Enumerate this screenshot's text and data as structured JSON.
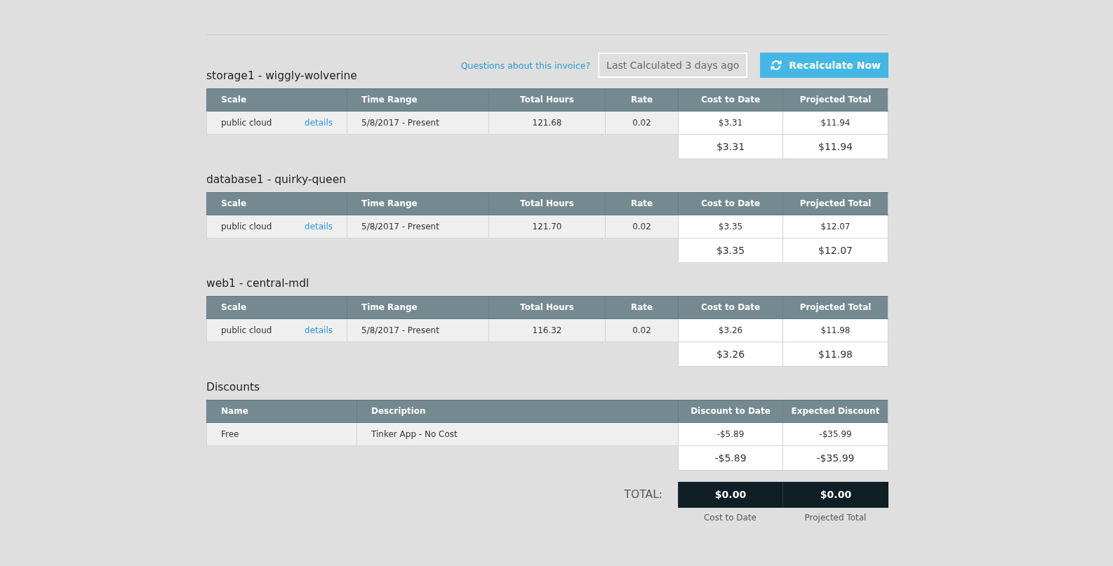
{
  "header": {
    "help_link": "Questions about this invoice?",
    "last_calculated": "Last Calculated 3 days ago",
    "recalculate_button": "Recalculate Now"
  },
  "sections": [
    {
      "title": "storage1 - wiggly-wolverine",
      "columns": [
        "Scale",
        "Time Range",
        "Total Hours",
        "Rate",
        "Cost to Date",
        "Projected Total"
      ],
      "rows": [
        {
          "cells": [
            "public cloud",
            "5/8/2017 - Present",
            "121.68",
            "0.02",
            "$3.31",
            "$11.94"
          ],
          "link": "details"
        }
      ],
      "subtotal": [
        "$3.31",
        "$11.94"
      ]
    },
    {
      "title": "database1 - quirky-queen",
      "columns": [
        "Scale",
        "Time Range",
        "Total Hours",
        "Rate",
        "Cost to Date",
        "Projected Total"
      ],
      "rows": [
        {
          "cells": [
            "public cloud",
            "5/8/2017 - Present",
            "121.70",
            "0.02",
            "$3.35",
            "$12.07"
          ],
          "link": "details"
        }
      ],
      "subtotal": [
        "$3.35",
        "$12.07"
      ]
    },
    {
      "title": "web1 - central-mdl",
      "columns": [
        "Scale",
        "Time Range",
        "Total Hours",
        "Rate",
        "Cost to Date",
        "Projected Total"
      ],
      "rows": [
        {
          "cells": [
            "public cloud",
            "5/8/2017 - Present",
            "116.32",
            "0.02",
            "$3.26",
            "$11.98"
          ],
          "link": "details"
        }
      ],
      "subtotal": [
        "$3.26",
        "$11.98"
      ]
    },
    {
      "title": "Discounts",
      "columns": [
        "Name",
        "Description",
        "Discount to Date",
        "Expected Discount"
      ],
      "rows": [
        {
          "cells": [
            "Free",
            "Tinker App - No Cost",
            "-$5.89",
            "-$35.99"
          ]
        }
      ],
      "subtotal": [
        "-$5.89",
        "-$35.99"
      ]
    }
  ],
  "total": {
    "label": "TOTAL:",
    "values": [
      "$0.00",
      "$0.00"
    ],
    "captions": [
      "Cost to Date",
      "Projected Total"
    ]
  }
}
